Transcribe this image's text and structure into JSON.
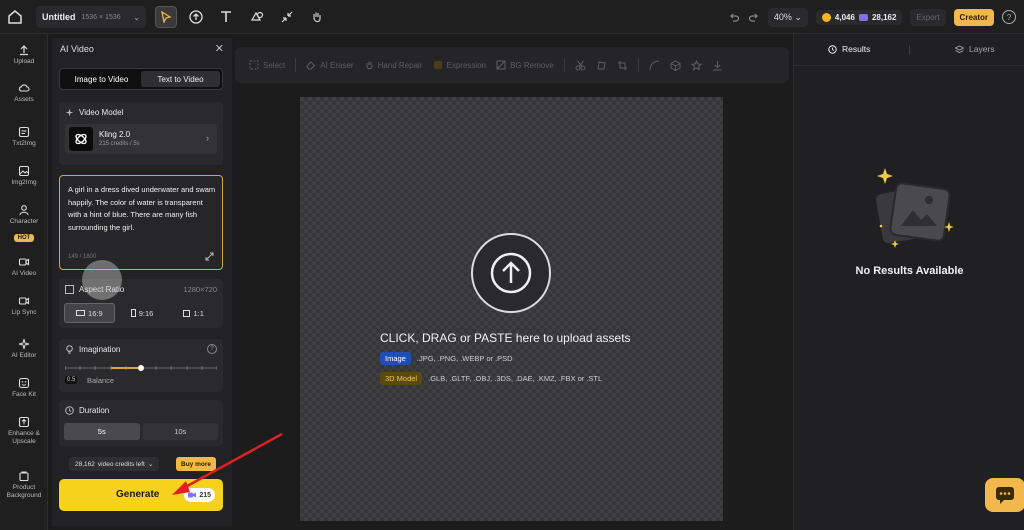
{
  "topbar": {
    "project_name": "Untitled",
    "project_size": "1536 × 1536",
    "zoom": "40%",
    "coins": "4,046",
    "gems": "28,162",
    "export_label": "Export",
    "creator_label": "Creator",
    "help_label": "?"
  },
  "rail": {
    "items": [
      {
        "label": "Upload",
        "icon": "upload-icon"
      },
      {
        "label": "Assets",
        "icon": "cloud-icon"
      },
      {
        "label": "Txt2Img",
        "icon": "text-image-icon"
      },
      {
        "label": "Img2Img",
        "icon": "image-icon"
      },
      {
        "label": "Character",
        "icon": "character-icon"
      },
      {
        "label": "AI Video",
        "icon": "video-icon"
      },
      {
        "label": "Lip Sync",
        "icon": "lipsync-icon"
      },
      {
        "label": "AI Editor",
        "icon": "sparkle-icon"
      },
      {
        "label": "Face Kit",
        "icon": "face-icon"
      },
      {
        "label": "Enhance &",
        "icon": "enhance-icon"
      },
      {
        "label": "Upscale",
        "icon": ""
      },
      {
        "label": "Product",
        "icon": "product-icon"
      },
      {
        "label": "Background",
        "icon": ""
      }
    ],
    "hot_badge": "HOT"
  },
  "panel": {
    "title": "AI Video",
    "tabs": {
      "image_to_video": "Image to Video",
      "text_to_video": "Text to Video"
    },
    "video_model_title": "Video Model",
    "model_name": "Kling 2.0",
    "model_credits": "215 credits / 5s",
    "prompt": "A girl in a dress dived underwater and swam happily. The color of water is transparent with a hint of blue. There are many fish surrounding the girl.",
    "prompt_count": "149 / 1800",
    "aspect_ratio_title": "Aspect Ratio",
    "aspect_ratio_resolution": "1280×720",
    "aspect_options": [
      "16:9",
      "9:16",
      "1:1"
    ],
    "aspect_selected": "16:9",
    "imagination_title": "Imagination",
    "imagination_value": "0.5",
    "imagination_label": "Balance",
    "imagination_level": 0.5,
    "duration_title": "Duration",
    "duration_options": [
      "5s",
      "10s"
    ],
    "duration_selected": "5s",
    "video_credits": "28,162",
    "video_credits_suffix": "video credits left",
    "buy_more": "Buy more",
    "generate_label": "Generate",
    "generate_cost": "215"
  },
  "canvas_toolbar": {
    "items": [
      "Select",
      "AI Eraser",
      "Hand Repair",
      "Expression",
      "BG Remove"
    ]
  },
  "canvas": {
    "drop_text": "CLICK, DRAG or PASTE here to upload assets",
    "image_tag": "Image",
    "image_formats": ".JPG, .PNG, .WEBP or .PSD",
    "model_tag": "3D Model",
    "model_formats": ".GLB, .GLTF, .OBJ, .3DS, .DAE, .KMZ, .FBX or .STL"
  },
  "right_panel": {
    "tab_results": "Results",
    "tab_layers": "Layers",
    "empty_text": "No Results Available"
  },
  "colors": {
    "accent_yellow": "#f6d21c",
    "prompt_border": "#d6a83a",
    "image_tag": "#1f4fb5",
    "annotation_arrow": "#e02020"
  }
}
